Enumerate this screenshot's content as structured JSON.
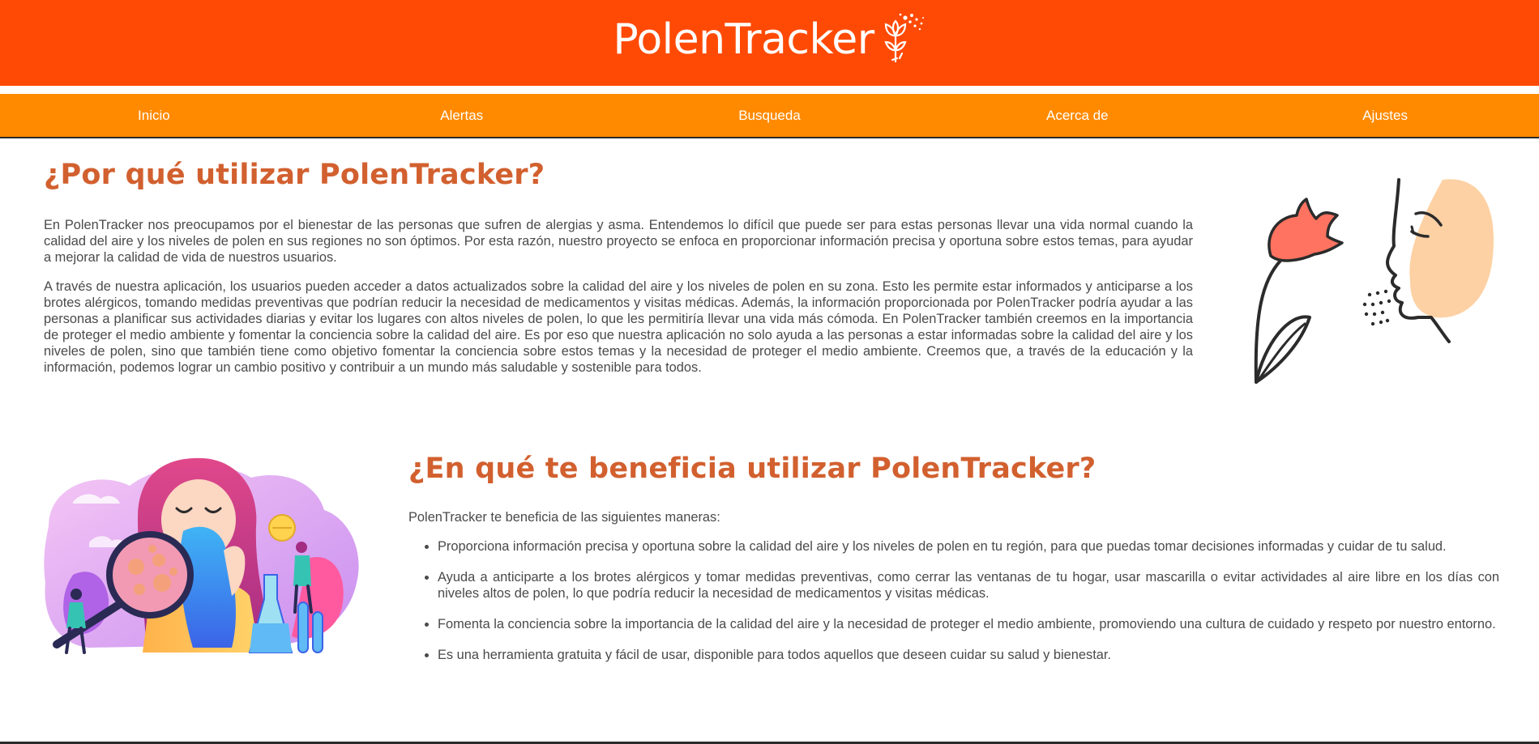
{
  "brand": {
    "name": "PolenTracker",
    "logo_icon": "flower-pollen-icon"
  },
  "colors": {
    "header_bg": "#ff4a05",
    "nav_bg": "#ff8a00",
    "heading": "#d2602f"
  },
  "nav": {
    "items": [
      "Inicio",
      "Alertas",
      "Busqueda",
      "Acerca de",
      "Ajustes"
    ]
  },
  "why": {
    "title": "¿Por qué utilizar PolenTracker?",
    "p1": "En PolenTracker nos preocupamos por el bienestar de las personas que sufren de alergias y asma. Entendemos lo difícil que puede ser para estas personas llevar una vida normal cuando la calidad del aire y los niveles de polen en sus regiones no son óptimos. Por esta razón, nuestro proyecto se enfoca en proporcionar información precisa y oportuna sobre estos temas, para ayudar a mejorar la calidad de vida de nuestros usuarios.",
    "p2": "A través de nuestra aplicación, los usuarios pueden acceder a datos actualizados sobre la calidad del aire y los niveles de polen en su zona. Esto les permite estar informados y anticiparse a los brotes alérgicos, tomando medidas preventivas que podrían reducir la necesidad de medicamentos y visitas médicas. Además, la información proporcionada por PolenTracker podría ayudar a las personas a planificar sus actividades diarias y evitar los lugares con altos niveles de polen, lo que les permitiría llevar una vida más cómoda. En PolenTracker también creemos en la importancia de proteger el medio ambiente y fomentar la conciencia sobre la calidad del aire. Es por eso que nuestra aplicación no solo ayuda a las personas a estar informadas sobre la calidad del aire y los niveles de polen, sino que también tiene como objetivo fomentar la conciencia sobre estos temas y la necesidad de proteger el medio ambiente. Creemos que, a través de la educación y la información, podemos lograr un cambio positivo y contribuir a un mundo más saludable y sostenible para todos."
  },
  "benefits": {
    "title": "¿En qué te beneficia utilizar PolenTracker?",
    "intro": "PolenTracker te beneficia de las siguientes maneras:",
    "items": [
      "Proporciona información precisa y oportuna sobre la calidad del aire y los niveles de polen en tu región, para que puedas tomar decisiones informadas y cuidar de tu salud.",
      "Ayuda a anticiparte a los brotes alérgicos y tomar medidas preventivas, como cerrar las ventanas de tu hogar, usar mascarilla o evitar actividades al aire libre en los días con niveles altos de polen, lo que podría reducir la necesidad de medicamentos y visitas médicas.",
      "Fomenta la conciencia sobre la importancia de la calidad del aire y la necesidad de proteger el medio ambiente, promoviendo una cultura de cuidado y respeto por nuestro entorno.",
      "Es una herramienta gratuita y fácil de usar, disponible para todos aquellos que deseen cuidar su salud y bienestar."
    ]
  },
  "illustrations": {
    "face": "person-smelling-flower-illustration",
    "allergy": "allergy-sneeze-illustration"
  }
}
